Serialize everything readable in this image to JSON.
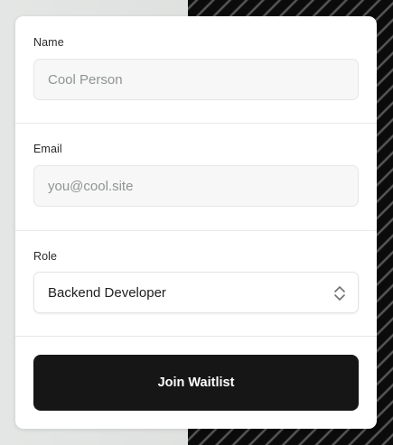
{
  "form": {
    "name": {
      "label": "Name",
      "placeholder": "Cool Person",
      "value": ""
    },
    "email": {
      "label": "Email",
      "placeholder": "you@cool.site",
      "value": ""
    },
    "role": {
      "label": "Role",
      "selected": "Backend Developer"
    },
    "submit_label": "Join Waitlist"
  },
  "colors": {
    "button_bg": "#161616",
    "card_bg": "#ffffff",
    "input_bg": "#f6f7f6"
  },
  "icons": {
    "select_chevron": "chevron-up-down-icon"
  }
}
